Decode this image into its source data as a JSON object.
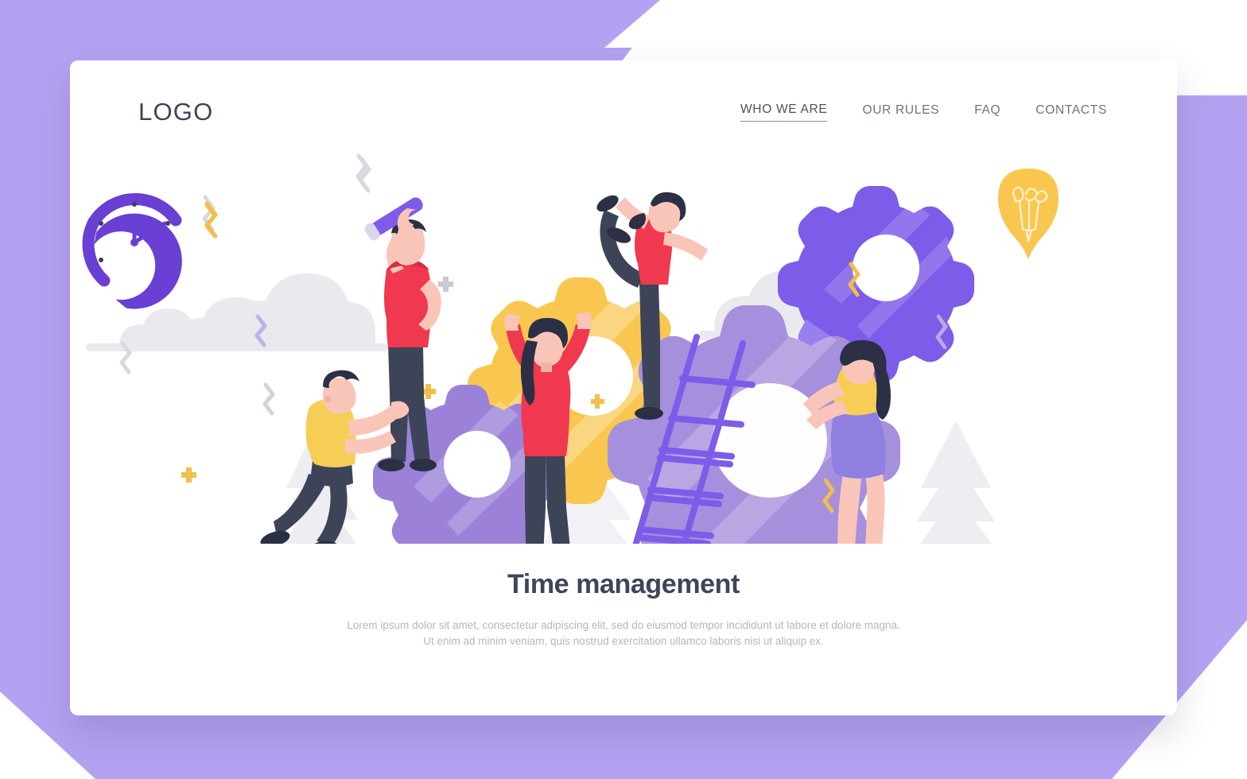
{
  "background": {
    "purple": "#b4a1f1",
    "white": "#ffffff"
  },
  "card": {
    "background": "#ffffff"
  },
  "header": {
    "logo": "LOGO",
    "nav": [
      {
        "label": "WHO WE ARE",
        "active": true
      },
      {
        "label": "OUR RULES",
        "active": false
      },
      {
        "label": "FAQ",
        "active": false
      },
      {
        "label": "CONTACTS",
        "active": false
      }
    ]
  },
  "hero": {
    "title": "Time management",
    "paragraph_line_1": "Lorem ipsum dolor sit amet, consectetur adipiscing elit, sed do eiusmod tempor incididunt ut labore et dolore magna.",
    "paragraph_line_2": "Ut enim ad minim veniam, quis nostrud exercitation ullamco laboris nisi ut aliquip ex."
  },
  "illustration": {
    "alt": "Team of people assembling gears around time management theme",
    "colors": {
      "gear_yellow": "#fac council",
      "gear_yellow_main": "#f9c74f",
      "gear_purple_bright": "#7c5ce8",
      "gear_purple_light": "#a68fdc",
      "gear_purple_medium": "#9b82d8",
      "cloud_gray": "#e9e9ee",
      "tree_gray": "#ededf2",
      "ground_gray": "#eceaf0",
      "shirt_red": "#f0384f",
      "shirt_yellow": "#f7ce55",
      "pants_navy": "#3d4458",
      "skin": "#f9c5b8",
      "hair_dark": "#2b3044",
      "clock_purple": "#6a3fd4",
      "bulb_yellow": "#f9c74f",
      "ladder_purple": "#7c5ce8",
      "squiggle_yellow": "#f0bf4c",
      "squiggle_gray": "#d8d8e0",
      "squiggle_purple": "#a090e0"
    },
    "elements": [
      {
        "name": "clock",
        "label": "clock-icon"
      },
      {
        "name": "cloud-left",
        "label": "cloud-icon"
      },
      {
        "name": "cloud-right",
        "label": "cloud-icon"
      },
      {
        "name": "lightbulb",
        "label": "lightbulb-icon"
      },
      {
        "name": "gear-yellow",
        "label": "gear-icon"
      },
      {
        "name": "gear-purple-large",
        "label": "gear-icon"
      },
      {
        "name": "gear-purple-small",
        "label": "gear-icon"
      },
      {
        "name": "gear-purple-bright",
        "label": "gear-icon"
      },
      {
        "name": "ladder",
        "label": "ladder-icon"
      },
      {
        "name": "person-telescope",
        "label": "person-with-telescope"
      },
      {
        "name": "person-yoga",
        "label": "person-yoga-pose"
      },
      {
        "name": "person-pushing-gear",
        "label": "person-pushing-gear"
      },
      {
        "name": "person-lifting-gear",
        "label": "person-lifting-gear"
      },
      {
        "name": "person-right",
        "label": "person-pushing-gear"
      }
    ]
  }
}
